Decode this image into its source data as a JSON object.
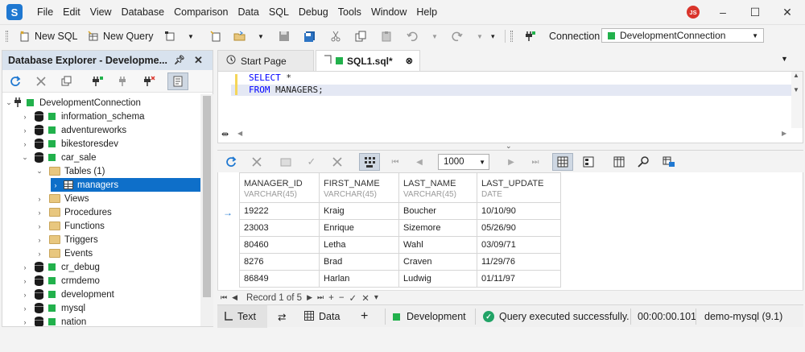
{
  "menu": [
    "File",
    "Edit",
    "View",
    "Database",
    "Comparison",
    "Data",
    "SQL",
    "Debug",
    "Tools",
    "Window",
    "Help"
  ],
  "user_initials": "JS",
  "toolbar": {
    "new_sql": "New SQL",
    "new_query": "New Query",
    "connection_label": "Connection",
    "connection_value": "DevelopmentConnection"
  },
  "explorer": {
    "title": "Database Explorer - Developme...",
    "tree": [
      {
        "label": "DevelopmentConnection",
        "kind": "connection"
      },
      {
        "label": "information_schema",
        "kind": "db"
      },
      {
        "label": "adventureworks",
        "kind": "db"
      },
      {
        "label": "bikestoresdev",
        "kind": "db"
      },
      {
        "label": "car_sale",
        "kind": "db"
      },
      {
        "label": "Tables (1)",
        "kind": "folder"
      },
      {
        "label": "managers",
        "kind": "table"
      },
      {
        "label": "Views",
        "kind": "folder"
      },
      {
        "label": "Procedures",
        "kind": "folder"
      },
      {
        "label": "Functions",
        "kind": "folder"
      },
      {
        "label": "Triggers",
        "kind": "folder"
      },
      {
        "label": "Events",
        "kind": "folder"
      },
      {
        "label": "cr_debug",
        "kind": "db"
      },
      {
        "label": "crmdemo",
        "kind": "db"
      },
      {
        "label": "development",
        "kind": "db"
      },
      {
        "label": "mysql",
        "kind": "db"
      },
      {
        "label": "nation",
        "kind": "db"
      }
    ]
  },
  "tabs": [
    {
      "label": "Start Page"
    },
    {
      "label": "SQL1.sql*"
    }
  ],
  "editor": {
    "line1_kw": "SELECT",
    "line1_rest": " *",
    "line2_kw": "FROM",
    "line2_rest": " MANAGERS;"
  },
  "grid_toolbar": {
    "row_limit": "1000"
  },
  "grid": {
    "columns": [
      {
        "name": "MANAGER_ID",
        "type": "VARCHAR(45)"
      },
      {
        "name": "FIRST_NAME",
        "type": "VARCHAR(45)"
      },
      {
        "name": "LAST_NAME",
        "type": "VARCHAR(45)"
      },
      {
        "name": "LAST_UPDATE",
        "type": "DATE"
      }
    ],
    "rows": [
      [
        "19222",
        "Kraig",
        "Boucher",
        "10/10/90"
      ],
      [
        "23003",
        "Enrique",
        "Sizemore",
        "05/26/90"
      ],
      [
        "80460",
        "Letha",
        "Wahl",
        "03/09/71"
      ],
      [
        "8276",
        "Brad",
        "Craven",
        "11/29/76"
      ],
      [
        "86849",
        "Harlan",
        "Ludwig",
        "01/11/97"
      ]
    ]
  },
  "navigation": {
    "record_text": "Record 1 of 5"
  },
  "status": {
    "text_tab": "Text",
    "data_tab": "Data",
    "connection": "Development",
    "message": "Query executed successfully.",
    "elapsed": "00:00:00.101",
    "server": "demo-mysql (9.1)"
  },
  "colors": {
    "accent": "#0e6fc9",
    "success": "#21a366",
    "connection_green": "#22b14c",
    "keyword": "#0000ff"
  }
}
